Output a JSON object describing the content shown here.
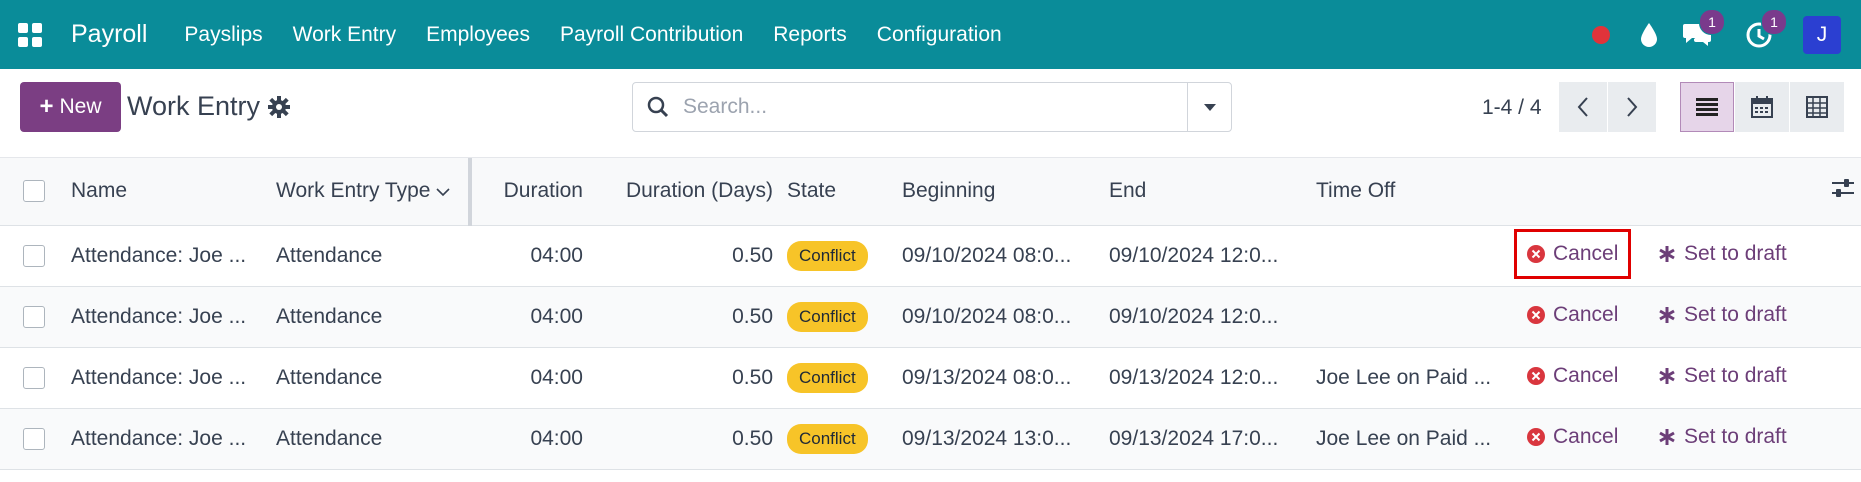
{
  "navbar": {
    "app_name": "Payroll",
    "menu": [
      "Payslips",
      "Work Entry",
      "Employees",
      "Payroll Contribution",
      "Reports",
      "Configuration"
    ],
    "discuss_badge": "1",
    "activity_badge": "1",
    "avatar_letter": "J"
  },
  "control_panel": {
    "new_label": "New",
    "title": "Work Entry",
    "search_placeholder": "Search...",
    "pager": "1-4 / 4"
  },
  "table": {
    "headers": [
      "Name",
      "Work Entry Type",
      "Duration",
      "Duration (Days)",
      "State",
      "Beginning",
      "End",
      "Time Off"
    ],
    "rows": [
      {
        "name": "Attendance: Joe ...",
        "type": "Attendance",
        "duration": "04:00",
        "days": "0.50",
        "state": "Conflict",
        "beginning": "09/10/2024 08:0...",
        "end": "09/10/2024 12:0...",
        "time_off": ""
      },
      {
        "name": "Attendance: Joe ...",
        "type": "Attendance",
        "duration": "04:00",
        "days": "0.50",
        "state": "Conflict",
        "beginning": "09/10/2024 08:0...",
        "end": "09/10/2024 12:0...",
        "time_off": ""
      },
      {
        "name": "Attendance: Joe ...",
        "type": "Attendance",
        "duration": "04:00",
        "days": "0.50",
        "state": "Conflict",
        "beginning": "09/13/2024 08:0...",
        "end": "09/13/2024 12:0...",
        "time_off": "Joe Lee on Paid ..."
      },
      {
        "name": "Attendance: Joe ...",
        "type": "Attendance",
        "duration": "04:00",
        "days": "0.50",
        "state": "Conflict",
        "beginning": "09/13/2024 13:0...",
        "end": "09/13/2024 17:0...",
        "time_off": "Joe Lee on Paid ..."
      }
    ],
    "cancel_label": "Cancel",
    "draft_label": "Set to draft"
  },
  "colors": {
    "navbar": "#0a8c99",
    "primary": "#7b3e83",
    "conflict": "#f7c428",
    "highlight": "#e00000"
  }
}
